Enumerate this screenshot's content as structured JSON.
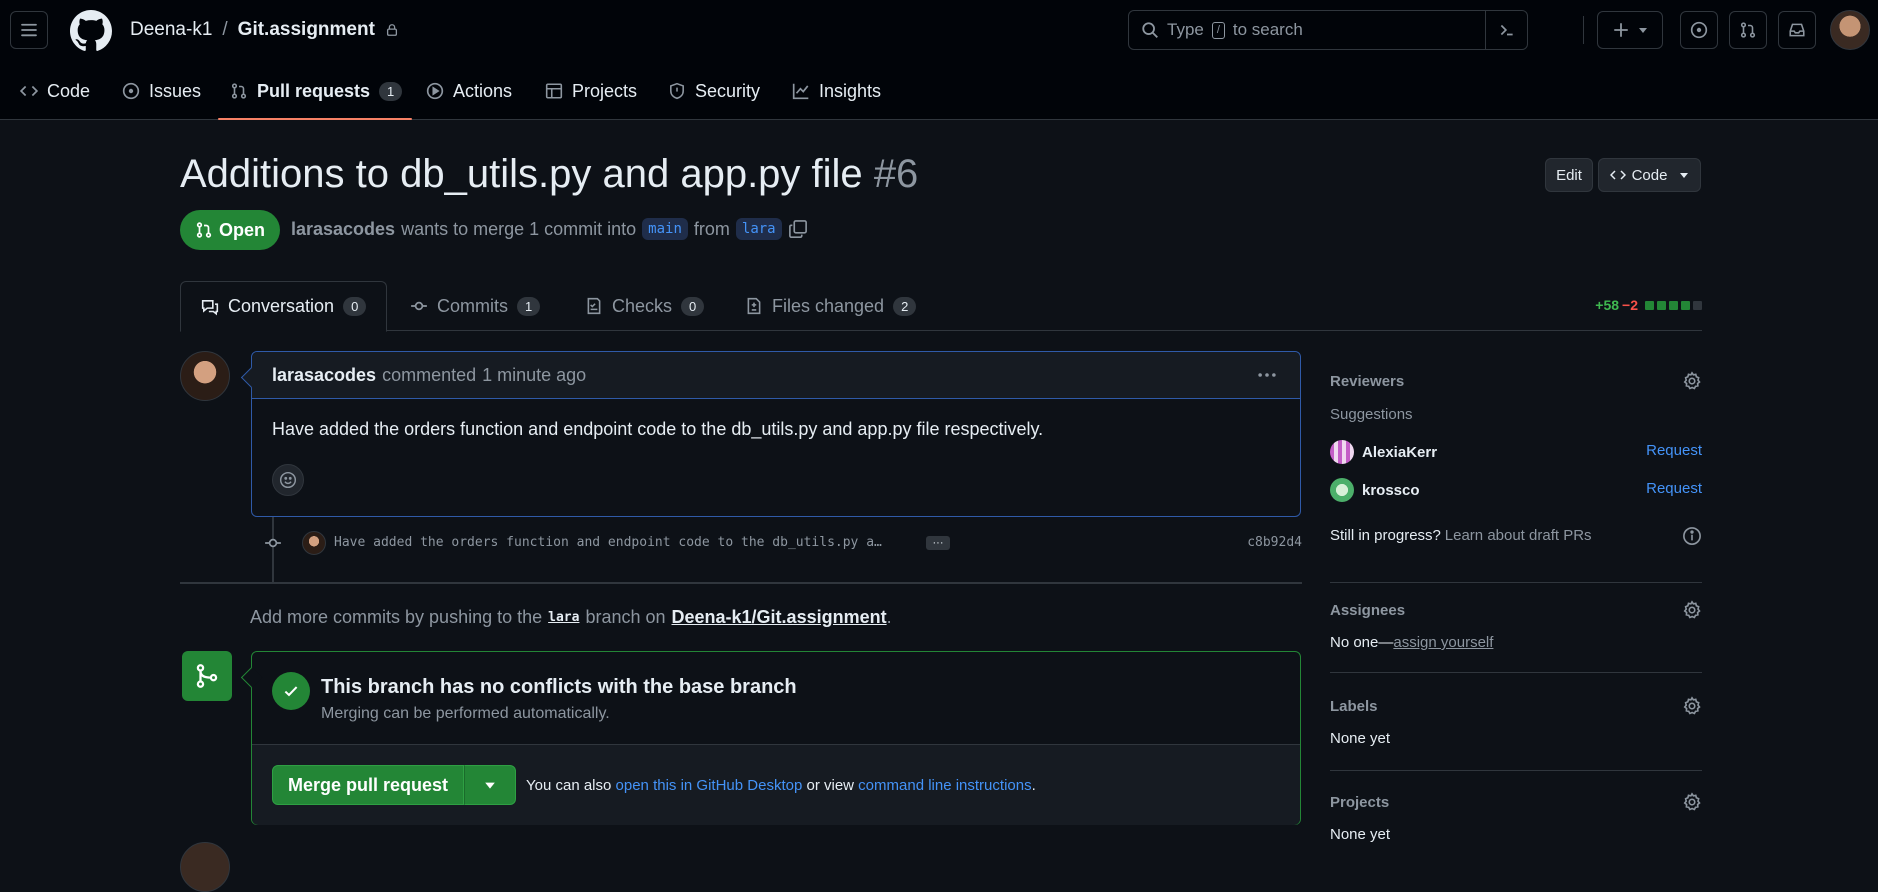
{
  "header": {
    "owner": "Deena-k1",
    "separator": "/",
    "repo": "Git.assignment",
    "search_prefix": "Type",
    "search_key": "/",
    "search_suffix": "to search"
  },
  "repo_nav": {
    "code": "Code",
    "issues": "Issues",
    "pull_requests": "Pull requests",
    "pull_requests_count": "1",
    "actions": "Actions",
    "projects": "Projects",
    "security": "Security",
    "insights": "Insights"
  },
  "pr": {
    "title": "Additions to db_utils.py and app.py file",
    "number": "#6",
    "edit_label": "Edit",
    "code_label": "Code",
    "state": "Open",
    "author": "larasacodes",
    "merge_text": "wants to merge 1 commit into",
    "base_branch": "main",
    "from_text": "from",
    "head_branch": "lara"
  },
  "tabs": [
    {
      "label": "Conversation",
      "count": "0"
    },
    {
      "label": "Commits",
      "count": "1"
    },
    {
      "label": "Checks",
      "count": "0"
    },
    {
      "label": "Files changed",
      "count": "2"
    }
  ],
  "diffstat": {
    "additions": "+58",
    "deletions": "−2"
  },
  "comment": {
    "author": "larasacodes",
    "action": "commented",
    "time": "1 minute ago",
    "body": "Have added the orders function and endpoint code to the db_utils.py and app.py file respectively."
  },
  "commit": {
    "message": "Have added the orders function and endpoint code to the db_utils.py a…",
    "ellipsis": "···",
    "sha": "c8b92d4"
  },
  "push_hint": {
    "prefix": "Add more commits by pushing to the",
    "branch": "lara",
    "middle": "branch on",
    "repo_link": "Deena-k1/Git.assignment",
    "suffix": "."
  },
  "merge": {
    "title": "This branch has no conflicts with the base branch",
    "subtitle": "Merging can be performed automatically.",
    "button": "Merge pull request",
    "also_prefix": "You can also",
    "desktop_link": "open this in GitHub Desktop",
    "or_view": "or view",
    "cli_link": "command line instructions",
    "also_suffix": "."
  },
  "sidebar": {
    "reviewers": {
      "heading": "Reviewers",
      "suggestions": "Suggestions",
      "people": [
        {
          "name": "AlexiaKerr",
          "action": "Request"
        },
        {
          "name": "krossco",
          "action": "Request"
        }
      ],
      "in_progress": "Still in progress?",
      "draft_link": "Learn about draft PRs"
    },
    "assignees": {
      "heading": "Assignees",
      "none": "No one—",
      "assign_link": "assign yourself"
    },
    "labels": {
      "heading": "Labels",
      "value": "None yet"
    },
    "projects": {
      "heading": "Projects",
      "value": "None yet"
    }
  },
  "colors": {
    "bg": "#0d1117",
    "header_bg": "#010409",
    "border": "#30363d",
    "accent_green": "#238636",
    "link_blue": "#4493f8",
    "tab_underline": "#f78166"
  }
}
